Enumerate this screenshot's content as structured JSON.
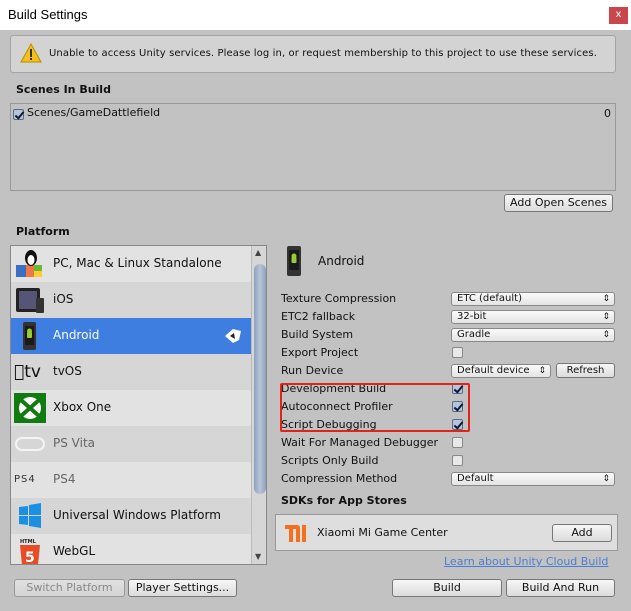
{
  "window": {
    "title": "Build Settings",
    "close_label": "x"
  },
  "warning": {
    "text": "Unable to access Unity services. Please log in, or request membership to this project to use these services."
  },
  "scenes": {
    "heading": "Scenes In Build",
    "items": [
      {
        "name": "Scenes/GameDattlefield",
        "index": "0",
        "checked": true
      }
    ],
    "add_open_scenes_label": "Add Open Scenes"
  },
  "platform": {
    "heading": "Platform",
    "items": [
      {
        "label": "PC, Mac & Linux Standalone",
        "icon": "pc-mac-linux-icon"
      },
      {
        "label": "iOS",
        "icon": "ios-icon"
      },
      {
        "label": "Android",
        "icon": "android-icon",
        "selected": true,
        "active": true
      },
      {
        "label": "tvOS",
        "icon": "tvos-icon"
      },
      {
        "label": "Xbox One",
        "icon": "xbox-icon"
      },
      {
        "label": "PS Vita",
        "icon": "psvita-icon"
      },
      {
        "label": "PS4",
        "icon": "ps4-icon"
      },
      {
        "label": "Universal Windows Platform",
        "icon": "windows-icon"
      },
      {
        "label": "WebGL",
        "icon": "html5-icon"
      }
    ]
  },
  "settings": {
    "platform_title": "Android",
    "texture_compression": {
      "label": "Texture Compression",
      "value": "ETC (default)"
    },
    "etc2_fallback": {
      "label": "ETC2 fallback",
      "value": "32-bit"
    },
    "build_system": {
      "label": "Build System",
      "value": "Gradle"
    },
    "export_project": {
      "label": "Export Project",
      "checked": false
    },
    "run_device": {
      "label": "Run Device",
      "value": "Default device",
      "refresh_label": "Refresh"
    },
    "development_build": {
      "label": "Development Build",
      "checked": true
    },
    "autoconnect_profiler": {
      "label": "Autoconnect Profiler",
      "checked": true
    },
    "script_debugging": {
      "label": "Script Debugging",
      "checked": true
    },
    "wait_managed_debugger": {
      "label": "Wait For Managed Debugger",
      "checked": false
    },
    "scripts_only_build": {
      "label": "Scripts Only Build",
      "checked": false
    },
    "compression_method": {
      "label": "Compression Method",
      "value": "Default"
    }
  },
  "sdks": {
    "heading": "SDKs for App Stores",
    "items": [
      {
        "name": "Xiaomi Mi Game Center",
        "add_label": "Add"
      }
    ],
    "cloud_link": "Learn about Unity Cloud Build"
  },
  "footer": {
    "switch_platform": "Switch Platform",
    "player_settings": "Player Settings...",
    "build": "Build",
    "build_and_run": "Build And Run"
  }
}
